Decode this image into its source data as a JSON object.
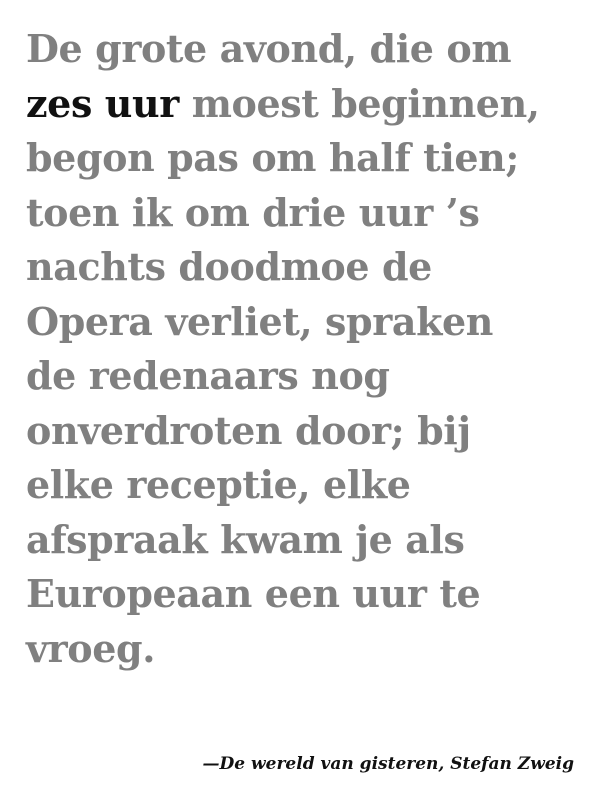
{
  "quote": {
    "lines": [
      {
        "highlight": "",
        "text": "De grote avond, die om"
      },
      {
        "highlight": "zes uur",
        "text": " moest beginnen,"
      },
      {
        "highlight": "",
        "text": "begon pas om half tien;"
      },
      {
        "highlight": "",
        "text": "toen ik om drie uur ’s"
      },
      {
        "highlight": "",
        "text": "nachts doodmoe de"
      },
      {
        "highlight": "",
        "text": "Opera verliet, spraken"
      },
      {
        "highlight": "",
        "text": "de redenaars nog"
      },
      {
        "highlight": "",
        "text": "onverdroten door; bij"
      },
      {
        "highlight": "",
        "text": "elke receptie, elke"
      },
      {
        "highlight": "",
        "text": "afspraak kwam je als"
      },
      {
        "highlight": "",
        "text": "Europeaan een uur te"
      },
      {
        "highlight": "",
        "text": "vroeg."
      }
    ]
  },
  "attribution": "—De wereld van gisteren, Stefan Zweig",
  "colors": {
    "body_text": "#808080",
    "highlight_text": "#111111",
    "background": "#ffffff"
  }
}
